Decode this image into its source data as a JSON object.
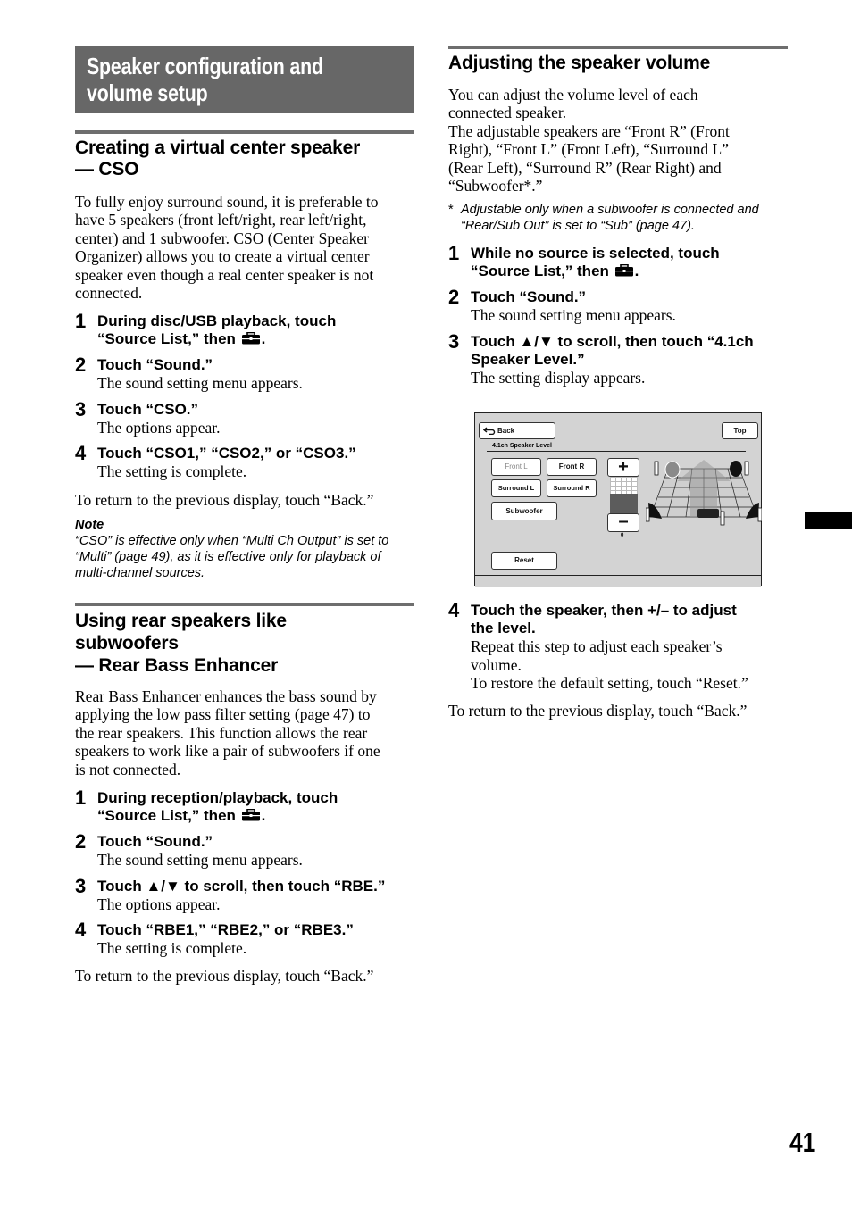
{
  "page_title": [
    "Speaker configuration and",
    "volume setup"
  ],
  "sections": {
    "cso": {
      "heading": [
        "Creating a virtual center speaker",
        "— CSO"
      ],
      "intro": [
        "To fully enjoy surround sound, it is preferable to",
        "have 5 speakers (front left/right, rear left/right,",
        "center) and 1 subwoofer. CSO (Center Speaker",
        "Organizer) allows you to create a virtual center",
        "speaker even though a real center speaker is not",
        "connected."
      ],
      "steps": [
        {
          "num": "1",
          "title_lines": [
            "During disc/USB playback, touch",
            "“Source List,” then"
          ],
          "icon": "toolbox-icon",
          "desc": []
        },
        {
          "num": "2",
          "title_lines": [
            "Touch “Sound.”"
          ],
          "desc": [
            "The sound setting menu appears."
          ]
        },
        {
          "num": "3",
          "title_lines": [
            "Touch “CSO.”"
          ],
          "desc": [
            "The options appear."
          ]
        },
        {
          "num": "4",
          "title_lines": [
            "Touch “CSO1,” “CSO2,” or “CSO3.”"
          ],
          "desc": [
            "The setting is complete."
          ]
        }
      ],
      "return_text": "To return to the previous display, touch “Back.”",
      "note_heading": "Note",
      "note_lines": [
        "“CSO” is effective only when “Multi Ch Output” is set to",
        "“Multi” (page 49), as it is effective only for playback of",
        "multi-channel sources."
      ]
    },
    "rbe": {
      "heading": [
        "Using rear speakers like",
        "subwoofers",
        "— Rear Bass Enhancer"
      ],
      "intro": [
        "Rear Bass Enhancer enhances the bass sound by",
        "applying the low pass filter setting (page 47) to",
        "the rear speakers. This function allows the rear",
        "speakers to work like a pair of subwoofers if one",
        "is not connected."
      ],
      "steps": [
        {
          "num": "1",
          "title_lines": [
            "During reception/playback, touch",
            "“Source List,” then"
          ],
          "icon": "toolbox-icon",
          "desc": []
        },
        {
          "num": "2",
          "title_lines": [
            "Touch “Sound.”"
          ],
          "desc": [
            "The sound setting menu appears."
          ]
        },
        {
          "num": "3",
          "title_lines": [
            "Touch ▲/▼ to scroll, then touch “RBE.”"
          ],
          "desc": [
            "The options appear."
          ]
        },
        {
          "num": "4",
          "title_lines": [
            "Touch “RBE1,” “RBE2,” or “RBE3.”"
          ],
          "desc": [
            "The setting is complete."
          ]
        }
      ],
      "return_text": "To return to the previous display, touch “Back.”"
    },
    "volume": {
      "heading": "Adjusting the speaker volume",
      "intro": [
        "You can adjust the volume level of each",
        "connected speaker.",
        "The adjustable speakers are “Front R” (Front",
        "Right), “Front L” (Front Left), “Surround L”",
        "(Rear Left), “Surround R” (Rear Right) and",
        "“Subwoofer*.”"
      ],
      "footnote_mark": "*",
      "footnote_lines": [
        "Adjustable only when a subwoofer is connected and",
        "“Rear/Sub Out” is set to “Sub” (page 47)."
      ],
      "steps": [
        {
          "num": "1",
          "title_lines": [
            "While no source is selected, touch",
            "“Source List,” then"
          ],
          "icon": "toolbox-icon",
          "desc": []
        },
        {
          "num": "2",
          "title_lines": [
            "Touch “Sound.”"
          ],
          "desc": [
            "The sound setting menu appears."
          ]
        },
        {
          "num": "3",
          "title_lines": [
            "Touch ▲/▼ to scroll, then touch “4.1ch",
            "Speaker Level.”"
          ],
          "desc": [
            "The setting display appears."
          ]
        },
        {
          "num": "4",
          "title_lines": [
            "Touch the speaker, then +/– to adjust",
            "the level."
          ],
          "desc": [
            "Repeat this step to adjust each speaker’s",
            "volume.",
            "To restore the default setting, touch “Reset.”"
          ]
        }
      ],
      "return_text": "To return to the previous display, touch “Back.”"
    }
  },
  "screen": {
    "back_label": "Back",
    "top_label": "Top",
    "title": "4.1ch Speaker Level",
    "speaker_buttons": [
      {
        "label": "Front L",
        "selected": true
      },
      {
        "label": "Front R",
        "selected": false
      },
      {
        "label": "Surround L",
        "selected": false
      },
      {
        "label": "Surround R",
        "selected": false
      },
      {
        "label": "Subwoofer",
        "selected": false
      }
    ],
    "plus_label": "+",
    "minus_label": "–",
    "level_value": "0",
    "reset_label": "Reset"
  },
  "page_number": "41"
}
